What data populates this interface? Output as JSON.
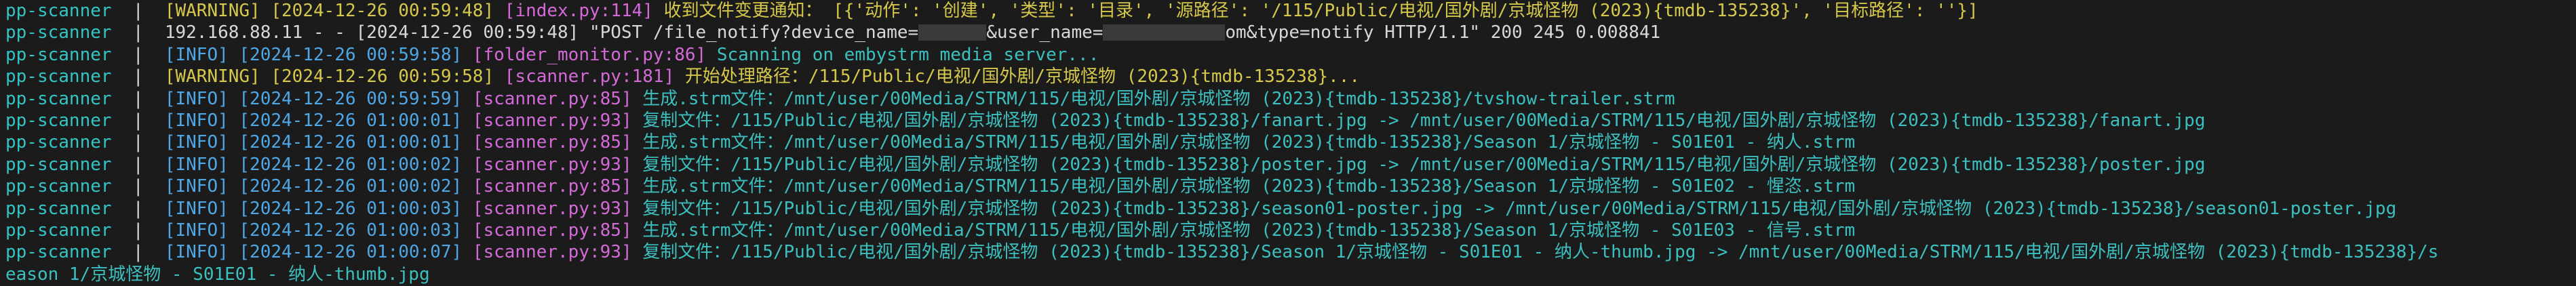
{
  "terminal": {
    "lines": [
      {
        "svc": "pp-scanner",
        "level": "[WARNING]",
        "ts": "[2024-12-26 00:59:48]",
        "src": "[index.py:114]",
        "kind": "warning",
        "msg": " 收到文件变更通知： [{'动作': '创建', '类型': '目录', '源路径': '/115/Public/电视/国外剧/京城怪物 (2023){tmdb-135238}', '目标路径': ''}]"
      },
      {
        "svc": "pp-scanner",
        "kind": "plain",
        "msg_a": "192.168.88.11 - - [2024-12-26 00:59:48] \"POST /file_notify?device_name=",
        "msg_b": "&user_name=",
        "msg_c": "om&type=notify HTTP/1.1\" 200 245 0.008841"
      },
      {
        "svc": "pp-scanner",
        "level": "[INFO]",
        "ts": "[2024-12-26 00:59:58]",
        "src": "[folder_monitor.py:86]",
        "kind": "info",
        "msg": " Scanning on embystrm media server..."
      },
      {
        "svc": "pp-scanner",
        "level": "[WARNING]",
        "ts": "[2024-12-26 00:59:58]",
        "src": "[scanner.py:181]",
        "kind": "warning",
        "msg": " 开始处理路径：/115/Public/电视/国外剧/京城怪物 (2023){tmdb-135238}..."
      },
      {
        "svc": "pp-scanner",
        "level": "[INFO]",
        "ts": "[2024-12-26 00:59:59]",
        "src": "[scanner.py:85]",
        "kind": "info",
        "msg": " 生成.strm文件：/mnt/user/00Media/STRM/115/电视/国外剧/京城怪物 (2023){tmdb-135238}/tvshow-trailer.strm"
      },
      {
        "svc": "pp-scanner",
        "level": "[INFO]",
        "ts": "[2024-12-26 01:00:01]",
        "src": "[scanner.py:93]",
        "kind": "info",
        "msg": " 复制文件：/115/Public/电视/国外剧/京城怪物 (2023){tmdb-135238}/fanart.jpg -> /mnt/user/00Media/STRM/115/电视/国外剧/京城怪物 (2023){tmdb-135238}/fanart.jpg"
      },
      {
        "svc": "pp-scanner",
        "level": "[INFO]",
        "ts": "[2024-12-26 01:00:01]",
        "src": "[scanner.py:85]",
        "kind": "info",
        "msg": " 生成.strm文件：/mnt/user/00Media/STRM/115/电视/国外剧/京城怪物 (2023){tmdb-135238}/Season 1/京城怪物 - S01E01 - 纳人.strm"
      },
      {
        "svc": "pp-scanner",
        "level": "[INFO]",
        "ts": "[2024-12-26 01:00:02]",
        "src": "[scanner.py:93]",
        "kind": "info",
        "msg": " 复制文件：/115/Public/电视/国外剧/京城怪物 (2023){tmdb-135238}/poster.jpg -> /mnt/user/00Media/STRM/115/电视/国外剧/京城怪物 (2023){tmdb-135238}/poster.jpg"
      },
      {
        "svc": "pp-scanner",
        "level": "[INFO]",
        "ts": "[2024-12-26 01:00:02]",
        "src": "[scanner.py:85]",
        "kind": "info",
        "msg": " 生成.strm文件：/mnt/user/00Media/STRM/115/电视/国外剧/京城怪物 (2023){tmdb-135238}/Season 1/京城怪物 - S01E02 - 惺恣.strm"
      },
      {
        "svc": "pp-scanner",
        "level": "[INFO]",
        "ts": "[2024-12-26 01:00:03]",
        "src": "[scanner.py:93]",
        "kind": "info",
        "msg": " 复制文件：/115/Public/电视/国外剧/京城怪物 (2023){tmdb-135238}/season01-poster.jpg -> /mnt/user/00Media/STRM/115/电视/国外剧/京城怪物 (2023){tmdb-135238}/season01-poster.jpg"
      },
      {
        "svc": "pp-scanner",
        "level": "[INFO]",
        "ts": "[2024-12-26 01:00:03]",
        "src": "[scanner.py:85]",
        "kind": "info",
        "msg": " 生成.strm文件：/mnt/user/00Media/STRM/115/电视/国外剧/京城怪物 (2023){tmdb-135238}/Season 1/京城怪物 - S01E03 - 信号.strm"
      },
      {
        "svc": "pp-scanner",
        "level": "[INFO]",
        "ts": "[2024-12-26 01:00:07]",
        "src": "[scanner.py:93]",
        "kind": "info",
        "msg": " 复制文件：/115/Public/电视/国外剧/京城怪物 (2023){tmdb-135238}/Season 1/京城怪物 - S01E01 - 纳人-thumb.jpg -> /mnt/user/00Media/STRM/115/电视/国外剧/京城怪物 (2023){tmdb-135238}/s"
      },
      {
        "kind": "continuation",
        "msg": "eason 1/京城怪物 - S01E01 - 纳人-thumb.jpg"
      }
    ]
  },
  "colors": {
    "background": "#1b1b1b",
    "service": "#32c5c3",
    "info": "#4ea7e6",
    "warning": "#d6c84a",
    "source": "#d46ad8",
    "message": "#3cc0bf"
  }
}
